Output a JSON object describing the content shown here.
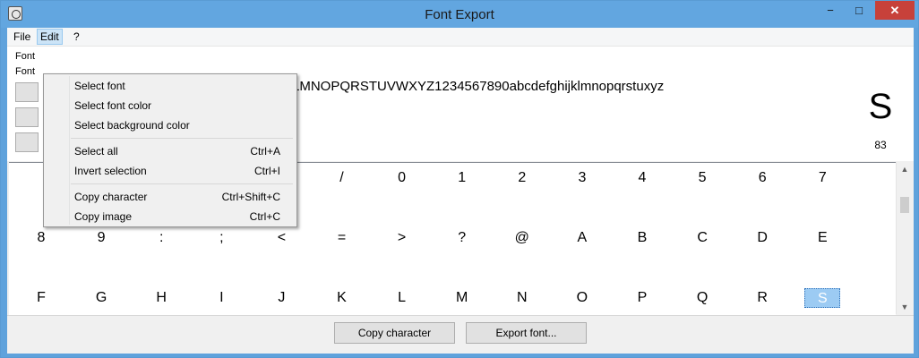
{
  "window": {
    "title": "Font Export"
  },
  "titlebar_controls": {
    "minimize": "−",
    "maximize": "□",
    "close": "✕"
  },
  "menubar": [
    {
      "label": "File"
    },
    {
      "label": "Edit"
    },
    {
      "label": "?"
    }
  ],
  "preview": {
    "label1": "Font",
    "label2": "Font",
    "sample_text": "LMNOPQRSTUVWXYZ1234567890abcdefghijklmnopqrstuxyz",
    "selected_char": "S",
    "selected_code": "83"
  },
  "edit_menu": {
    "items": [
      {
        "label": "Select font",
        "shortcut": ""
      },
      {
        "label": "Select font color",
        "shortcut": ""
      },
      {
        "label": "Select background color",
        "shortcut": ""
      },
      {
        "label": "Select all",
        "shortcut": "Ctrl+A"
      },
      {
        "label": "Invert selection",
        "shortcut": "Ctrl+I"
      },
      {
        "label": "Copy character",
        "shortcut": "Ctrl+Shift+C"
      },
      {
        "label": "Copy image",
        "shortcut": "Ctrl+C"
      }
    ]
  },
  "grid": {
    "rows": [
      [
        "",
        "",
        "",
        "",
        "",
        "/",
        "0",
        "1",
        "2",
        "3",
        "4",
        "5",
        "6",
        "7"
      ],
      [
        "8",
        "9",
        ":",
        ";",
        "<",
        "=",
        ">",
        "?",
        "@",
        "A",
        "B",
        "C",
        "D",
        "E"
      ],
      [
        "F",
        "G",
        "H",
        "I",
        "J",
        "K",
        "L",
        "M",
        "N",
        "O",
        "P",
        "Q",
        "R",
        "S"
      ]
    ],
    "selected": "S"
  },
  "buttons": {
    "copy_character": "Copy character",
    "export_font": "Export font..."
  },
  "icons": {
    "app": "app-icon",
    "scroll_up": "scroll-up-icon",
    "scroll_down": "scroll-down-icon"
  }
}
